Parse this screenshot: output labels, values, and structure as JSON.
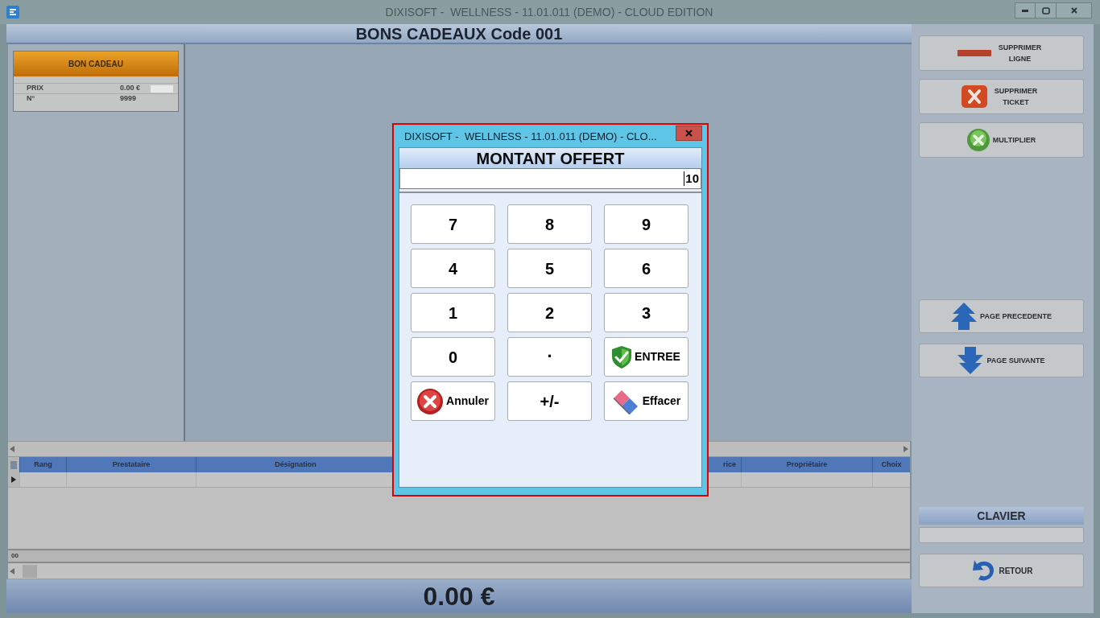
{
  "window": {
    "title": "DIXISOFT -  WELLNESS - 11.01.011 (DEMO) - CLOUD EDITION"
  },
  "header": {
    "title": "BONS CADEAUX Code 001"
  },
  "gift_card": {
    "title": "BON CADEAU",
    "fields": [
      {
        "label": "PRIX",
        "value": "0.00 €"
      },
      {
        "label": "N°",
        "value": "9999"
      }
    ]
  },
  "table": {
    "columns": [
      "Rang",
      "Prestataire",
      "Désignation",
      "rice",
      "Propriétaire",
      "Choix"
    ]
  },
  "status_bar": {
    "text": "00"
  },
  "total": "0.00 €",
  "side_buttons": [
    {
      "kind": "delete-line",
      "label": "SUPPRIMER LIGNE"
    },
    {
      "kind": "delete-ticket",
      "label": "SUPPRIMER TICKET"
    },
    {
      "kind": "multiply",
      "label": "MULTIPLIER"
    }
  ],
  "page_buttons": [
    {
      "kind": "previous-page",
      "label": "PAGE PRECEDENTE"
    },
    {
      "kind": "next-page",
      "label": "PAGE SUIVANTE"
    }
  ],
  "keyboard": {
    "title": "CLAVIER"
  },
  "return_button": {
    "label": "RETOUR"
  },
  "dialog": {
    "title": "DIXISOFT -  WELLNESS - 11.01.011 (DEMO) - CLO...",
    "heading": "MONTANT OFFERT",
    "value": "10",
    "keys": [
      {
        "kind": "digit",
        "label": "7"
      },
      {
        "kind": "digit",
        "label": "8"
      },
      {
        "kind": "digit",
        "label": "9"
      },
      {
        "kind": "digit",
        "label": "4"
      },
      {
        "kind": "digit",
        "label": "5"
      },
      {
        "kind": "digit",
        "label": "6"
      },
      {
        "kind": "digit",
        "label": "1"
      },
      {
        "kind": "digit",
        "label": "2"
      },
      {
        "kind": "digit",
        "label": "3"
      },
      {
        "kind": "digit",
        "label": "0"
      },
      {
        "kind": "point",
        "label": "."
      },
      {
        "kind": "enter",
        "label": "ENTREE"
      },
      {
        "kind": "cancel",
        "label": "Annuler"
      },
      {
        "kind": "digit",
        "label": "+/-"
      },
      {
        "kind": "clear",
        "label": "Effacer"
      }
    ]
  }
}
